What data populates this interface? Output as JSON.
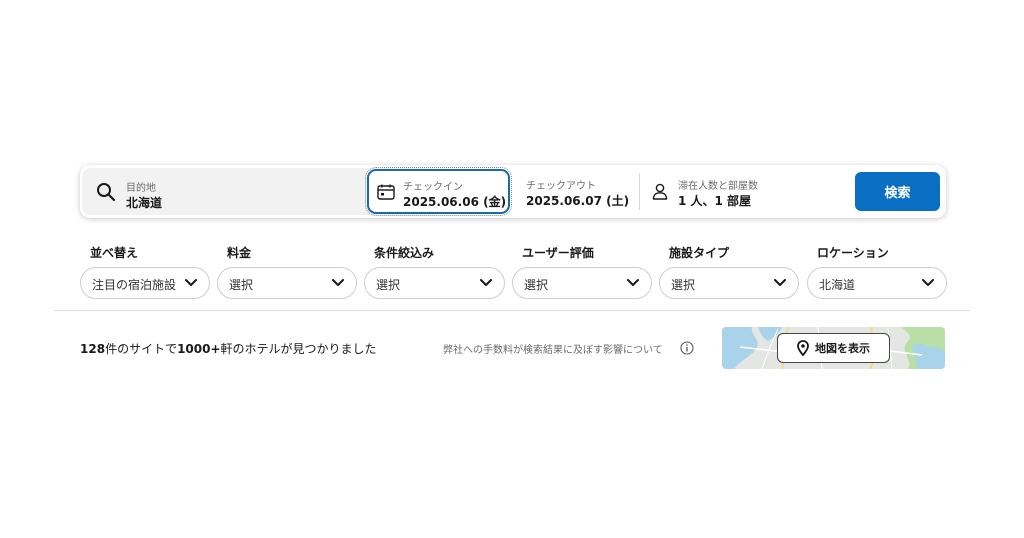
{
  "search": {
    "destination_label": "目的地",
    "destination_value": "北海道",
    "checkin_label": "チェックイン",
    "checkin_value": "2025.06.06 (金)",
    "checkout_label": "チェックアウト",
    "checkout_value": "2025.06.07 (土)",
    "guests_label": "滞在人数と部屋数",
    "guests_value": "1 人、1 部屋",
    "search_button": "検索"
  },
  "filters": [
    {
      "label": "並べ替え",
      "value": "注目の宿泊施設"
    },
    {
      "label": "料金",
      "value": "選択"
    },
    {
      "label": "条件絞込み",
      "value": "選択"
    },
    {
      "label": "ユーザー評価",
      "value": "選択"
    },
    {
      "label": "施設タイプ",
      "value": "選択"
    },
    {
      "label": "ロケーション",
      "value": "北海道"
    }
  ],
  "results": {
    "site_count": "128",
    "text_a": "件のサイトで",
    "hotel_count": "1000+",
    "text_b": "軒のホテルが見つかりました",
    "fee_note": "弊社への手数料が検索結果に及ぼす影響について"
  },
  "map": {
    "button_label": "地図を表示"
  },
  "colors": {
    "accent": "#0a6fc2",
    "focus_border": "#1a6aa6"
  }
}
